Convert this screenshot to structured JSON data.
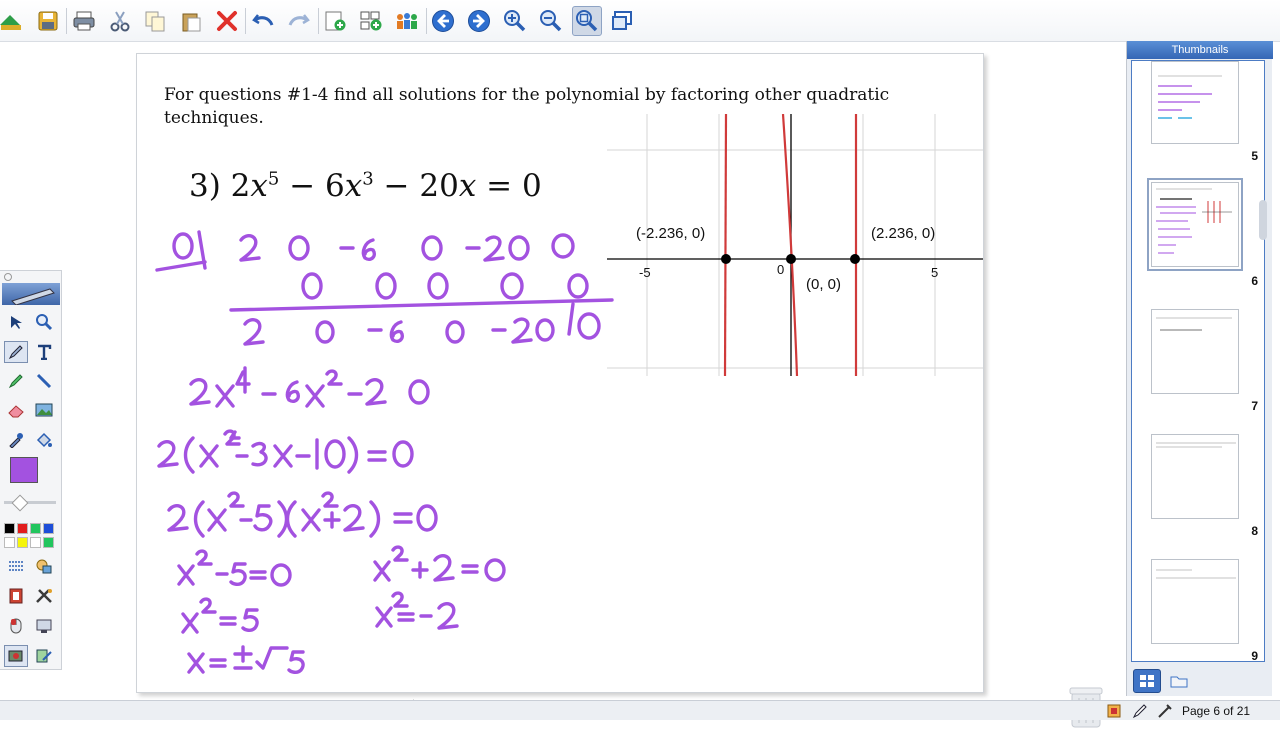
{
  "toolbar": {
    "buttons": [
      "open-icon",
      "save-icon",
      "print-icon",
      "cut-icon",
      "copy-icon",
      "paste-icon",
      "delete-icon",
      "undo-icon",
      "redo-icon",
      "add-page-icon",
      "add-slide-icon",
      "share-icon",
      "back-icon",
      "forward-icon",
      "zoom-in-icon",
      "zoom-out-icon",
      "zoom-fit-icon",
      "screen-capture-icon"
    ]
  },
  "page": {
    "instructions": "For questions #1-4 find all solutions for the polynomial by factoring other quadratic techniques.",
    "problem_prefix": "3) 2",
    "problem_middle1": " − 6",
    "problem_middle2": " − 20",
    "problem_suffix": " = 0",
    "var": "x",
    "exp1": "5",
    "exp2": "3"
  },
  "graph": {
    "labels": {
      "left_root": "(-2.236, 0)",
      "right_root": "(2.236, 0)",
      "origin_root": "(0, 0)",
      "tick_neg": "-5",
      "tick_zero": "0",
      "tick_pos": "5"
    },
    "roots": [
      -2.236,
      0,
      2.236
    ],
    "x_range": [
      -6.5,
      7.5
    ],
    "curve_color": "#d03a3a"
  },
  "ink_color": "#a352e0",
  "tools": {
    "palette": [
      "#000000",
      "#e11d1d",
      "#22c55e",
      "#1d4ed8",
      "#ffffff",
      "#f5f50a",
      "#ffffff",
      "#22c55e"
    ],
    "selected_color": "#a352e0"
  },
  "thumbnails": {
    "header": "Thumbnails",
    "items": [
      {
        "num": "5"
      },
      {
        "num": "6"
      },
      {
        "num": "7"
      },
      {
        "num": "8"
      },
      {
        "num": "9"
      }
    ],
    "selected": "6"
  },
  "status": {
    "page_indicator": "Page 6 of 21"
  }
}
